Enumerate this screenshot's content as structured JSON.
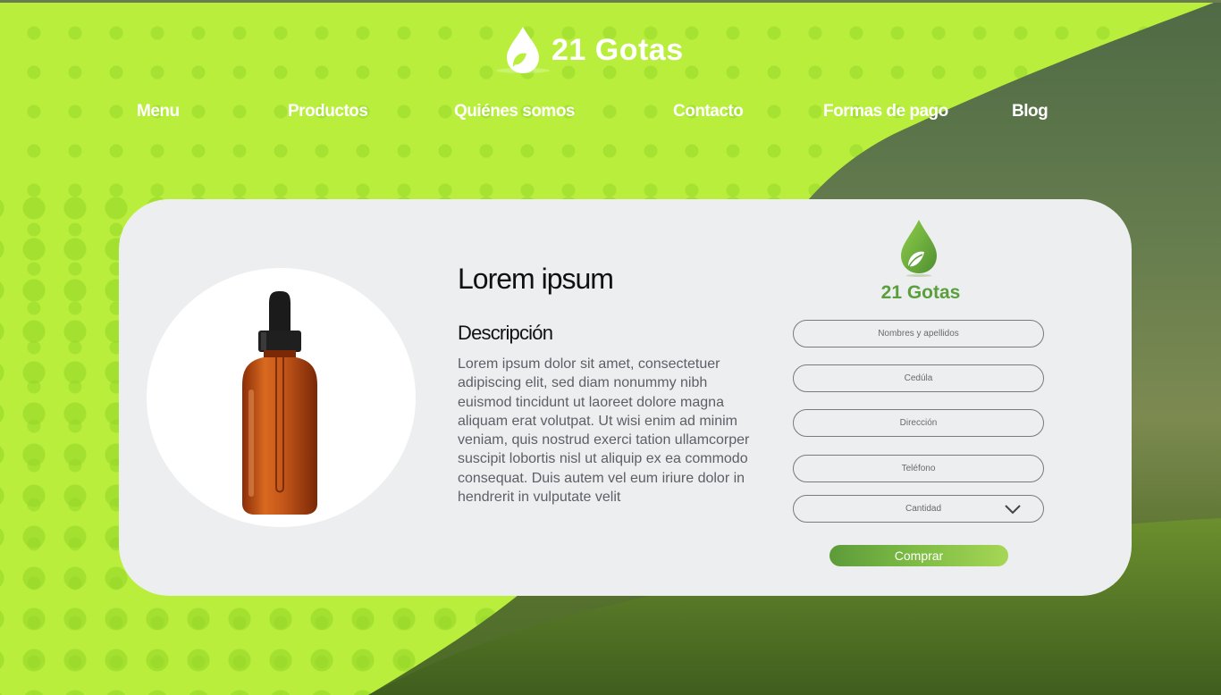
{
  "brand": {
    "name": "21 Gotas"
  },
  "nav": {
    "items": [
      "Menu",
      "Productos",
      "Quiénes somos",
      "Contacto",
      "Formas de pago",
      "Blog"
    ]
  },
  "product": {
    "title": "Lorem ipsum",
    "subtitle": "Descripción",
    "description": "Lorem ipsum dolor sit amet, consectetuer adipiscing elit, sed diam nonummy nibh euismod tincidunt ut laoreet dolore magna aliquam erat volutpat. Ut wisi enim ad minim veniam, quis nostrud exerci tation ullamcorper suscipit lobortis nisl ut aliquip ex ea commodo consequat. Duis autem vel eum iriure dolor in hendrerit in vulputate velit"
  },
  "form": {
    "brand": "21 Gotas",
    "name_placeholder": "Nombres y apellidos",
    "id_placeholder": "Cedúla",
    "address_placeholder": "Dirección",
    "phone_placeholder": "Teléfono",
    "quantity_label": "Cantidad",
    "buy_label": "Comprar"
  },
  "colors": {
    "lime_background": "#b9ef3c",
    "card": "#edeef0",
    "brand_green": "#5a9f3b",
    "bottle_amber": "#c4561a"
  },
  "icons": {
    "logo": "leaf-drop-icon",
    "select": "chevron-down-icon"
  }
}
